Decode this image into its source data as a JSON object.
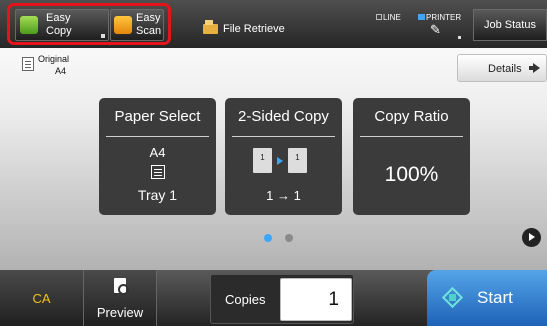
{
  "header": {
    "modes": [
      {
        "label_line1": "Easy",
        "label_line2": "Copy",
        "icon": "easy-copy-icon"
      },
      {
        "label_line1": "Easy",
        "label_line2": "Scan",
        "icon": "easy-scan-icon"
      }
    ],
    "file_retrieve_label": "File Retrieve",
    "line_label": "LINE",
    "printer_label": "PRINTER",
    "job_status_label": "Job Status"
  },
  "original": {
    "label": "Original",
    "size": "A4"
  },
  "details_label": "Details",
  "tiles": {
    "paper_select": {
      "title": "Paper Select",
      "size": "A4",
      "tray": "Tray 1"
    },
    "two_sided": {
      "title": "2-Sided Copy",
      "page_left": "1",
      "page_right": "1",
      "mode": "1 → 1"
    },
    "copy_ratio": {
      "title": "Copy Ratio",
      "value": "100%"
    }
  },
  "pager": {
    "pages": 2,
    "current": 1
  },
  "footer": {
    "ca_label": "CA",
    "preview_label": "Preview",
    "copies_label": "Copies",
    "copies_value": "1",
    "start_label": "Start"
  },
  "colors": {
    "accent_blue": "#3ca6ff",
    "highlight_red": "#e3151a",
    "ca_yellow": "#f3c01a",
    "start_blue": "#3a86d6"
  }
}
